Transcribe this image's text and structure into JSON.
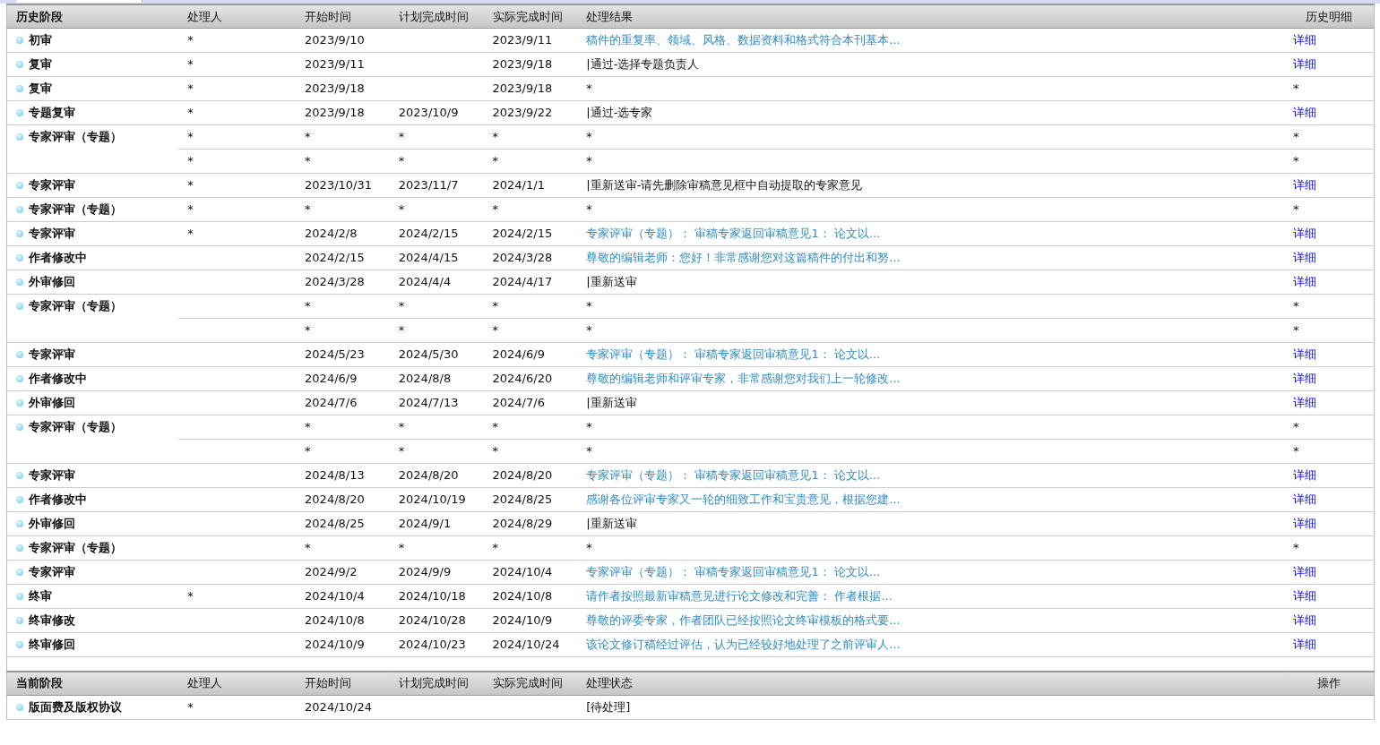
{
  "history": {
    "columns": [
      "历史阶段",
      "处理人",
      "开始时间",
      "计划完成时间",
      "实际完成时间",
      "处理结果",
      "历史明细"
    ],
    "rows": [
      {
        "stage": "初审",
        "entries": [
          {
            "handler": "*",
            "start": "2023/9/10",
            "actual": "2023/9/11",
            "result": "稿件的重复率、领域、风格、数据资料和格式符合本刊基本...",
            "result_link": true,
            "detail": "详细",
            "detail_link": true
          }
        ]
      },
      {
        "stage": "复审",
        "entries": [
          {
            "handler": "*",
            "start": "2023/9/11",
            "actual": "2023/9/18",
            "result": "|通过-选择专题负责人",
            "result_link": false,
            "detail": "详细",
            "detail_link": true
          }
        ]
      },
      {
        "stage": "复审",
        "entries": [
          {
            "handler": "*",
            "start": "2023/9/18",
            "actual": "2023/9/18",
            "result": "*",
            "result_link": false,
            "detail": "*",
            "detail_link": false
          }
        ]
      },
      {
        "stage": "专题复审",
        "entries": [
          {
            "handler": "*",
            "start": "2023/9/18",
            "planned": "2023/10/9",
            "actual": "2023/9/22",
            "result": "|通过-选专家",
            "result_link": false,
            "detail": "详细",
            "detail_link": true
          }
        ]
      },
      {
        "stage": "专家评审（专题）",
        "entries": [
          {
            "handler": "*",
            "start": "*",
            "planned": "*",
            "actual": "*",
            "result": "*",
            "result_link": false,
            "detail": "*",
            "detail_link": false
          },
          {
            "handler": "*",
            "start": "*",
            "planned": "*",
            "actual": "*",
            "result": "*",
            "result_link": false,
            "detail": "*",
            "detail_link": false
          }
        ]
      },
      {
        "stage": "专家评审",
        "entries": [
          {
            "handler": "*",
            "start": "2023/10/31",
            "planned": "2023/11/7",
            "actual": "2024/1/1",
            "result": "|重新送审-请先删除审稿意见框中自动提取的专家意见",
            "result_link": false,
            "detail": "详细",
            "detail_link": true
          }
        ]
      },
      {
        "stage": "专家评审（专题）",
        "entries": [
          {
            "handler": "*",
            "start": "*",
            "planned": "*",
            "actual": "*",
            "result": "*",
            "result_link": false,
            "detail": "*",
            "detail_link": false
          }
        ]
      },
      {
        "stage": "专家评审",
        "entries": [
          {
            "handler": "*",
            "start": "2024/2/8",
            "planned": "2024/2/15",
            "actual": "2024/2/15",
            "result": "专家评审（专题）： 审稿专家返回审稿意见1： 论文以...",
            "result_link": true,
            "detail": "详细",
            "detail_link": true
          }
        ]
      },
      {
        "stage": "作者修改中",
        "entries": [
          {
            "start": "2024/2/15",
            "planned": "2024/4/15",
            "actual": "2024/3/28",
            "result": "尊敬的编辑老师：您好！非常感谢您对这篇稿件的付出和努...",
            "result_link": true,
            "detail": "详细",
            "detail_link": true
          }
        ]
      },
      {
        "stage": "外审修回",
        "entries": [
          {
            "start": "2024/3/28",
            "planned": "2024/4/4",
            "actual": "2024/4/17",
            "result": "|重新送审",
            "result_link": false,
            "detail": "详细",
            "detail_link": true
          }
        ]
      },
      {
        "stage": "专家评审（专题）",
        "entries": [
          {
            "start": "*",
            "planned": "*",
            "actual": "*",
            "result": "*",
            "result_link": false,
            "detail": "*",
            "detail_link": false
          },
          {
            "start": "*",
            "planned": "*",
            "actual": "*",
            "result": "*",
            "result_link": false,
            "detail": "*",
            "detail_link": false
          }
        ]
      },
      {
        "stage": "专家评审",
        "entries": [
          {
            "start": "2024/5/23",
            "planned": "2024/5/30",
            "actual": "2024/6/9",
            "result": "专家评审（专题）： 审稿专家返回审稿意见1： 论文以...",
            "result_link": true,
            "detail": "详细",
            "detail_link": true
          }
        ]
      },
      {
        "stage": "作者修改中",
        "entries": [
          {
            "start": "2024/6/9",
            "planned": "2024/8/8",
            "actual": "2024/6/20",
            "result": "尊敬的编辑老师和评审专家，非常感谢您对我们上一轮修改...",
            "result_link": true,
            "detail": "详细",
            "detail_link": true
          }
        ]
      },
      {
        "stage": "外审修回",
        "entries": [
          {
            "start": "2024/7/6",
            "planned": "2024/7/13",
            "actual": "2024/7/6",
            "result": "|重新送审",
            "result_link": false,
            "detail": "详细",
            "detail_link": true
          }
        ]
      },
      {
        "stage": "专家评审（专题）",
        "entries": [
          {
            "start": "*",
            "planned": "*",
            "actual": "*",
            "result": "*",
            "result_link": false,
            "detail": "*",
            "detail_link": false
          },
          {
            "start": "*",
            "planned": "*",
            "actual": "*",
            "result": "*",
            "result_link": false,
            "detail": "*",
            "detail_link": false
          }
        ]
      },
      {
        "stage": "专家评审",
        "entries": [
          {
            "start": "2024/8/13",
            "planned": "2024/8/20",
            "actual": "2024/8/20",
            "result": "专家评审（专题）： 审稿专家返回审稿意见1： 论文以...",
            "result_link": true,
            "detail": "详细",
            "detail_link": true
          }
        ]
      },
      {
        "stage": "作者修改中",
        "entries": [
          {
            "start": "2024/8/20",
            "planned": "2024/10/19",
            "actual": "2024/8/25",
            "result": "感谢各位评审专家又一轮的细致工作和宝贵意见，根据您建...",
            "result_link": true,
            "detail": "详细",
            "detail_link": true
          }
        ]
      },
      {
        "stage": "外审修回",
        "entries": [
          {
            "start": "2024/8/25",
            "planned": "2024/9/1",
            "actual": "2024/8/29",
            "result": "|重新送审",
            "result_link": false,
            "detail": "详细",
            "detail_link": true
          }
        ]
      },
      {
        "stage": "专家评审（专题）",
        "entries": [
          {
            "start": "*",
            "planned": "*",
            "actual": "*",
            "result": "*",
            "result_link": false,
            "detail": "*",
            "detail_link": false
          }
        ]
      },
      {
        "stage": "专家评审",
        "entries": [
          {
            "start": "2024/9/2",
            "planned": "2024/9/9",
            "actual": "2024/10/4",
            "result": "专家评审（专题）： 审稿专家返回审稿意见1： 论文以...",
            "result_link": true,
            "detail": "详细",
            "detail_link": true
          }
        ]
      },
      {
        "stage": "终审",
        "entries": [
          {
            "handler": "*",
            "start": "2024/10/4",
            "planned": "2024/10/18",
            "actual": "2024/10/8",
            "result": "请作者按照最新审稿意见进行论文修改和完善： 作者根据...",
            "result_link": true,
            "detail": "详细",
            "detail_link": true
          }
        ]
      },
      {
        "stage": "终审修改",
        "entries": [
          {
            "start": "2024/10/8",
            "planned": "2024/10/28",
            "actual": "2024/10/9",
            "result": "尊敬的评委专家，作者团队已经按照论文终审模板的格式要...",
            "result_link": true,
            "detail": "详细",
            "detail_link": true
          }
        ]
      },
      {
        "stage": "终审修回",
        "entries": [
          {
            "start": "2024/10/9",
            "planned": "2024/10/23",
            "actual": "2024/10/24",
            "result": "该论文修订稿经过评估，认为已经较好地处理了之前评审人...",
            "result_link": true,
            "detail": "详细",
            "detail_link": true
          }
        ]
      }
    ]
  },
  "current": {
    "columns": [
      "当前阶段",
      "处理人",
      "开始时间",
      "计划完成时间",
      "实际完成时间",
      "处理状态",
      "操作"
    ],
    "rows": [
      {
        "stage": "版面费及版权协议",
        "handler": "*",
        "start": "2024/10/24",
        "status": "[待处理]"
      }
    ]
  }
}
